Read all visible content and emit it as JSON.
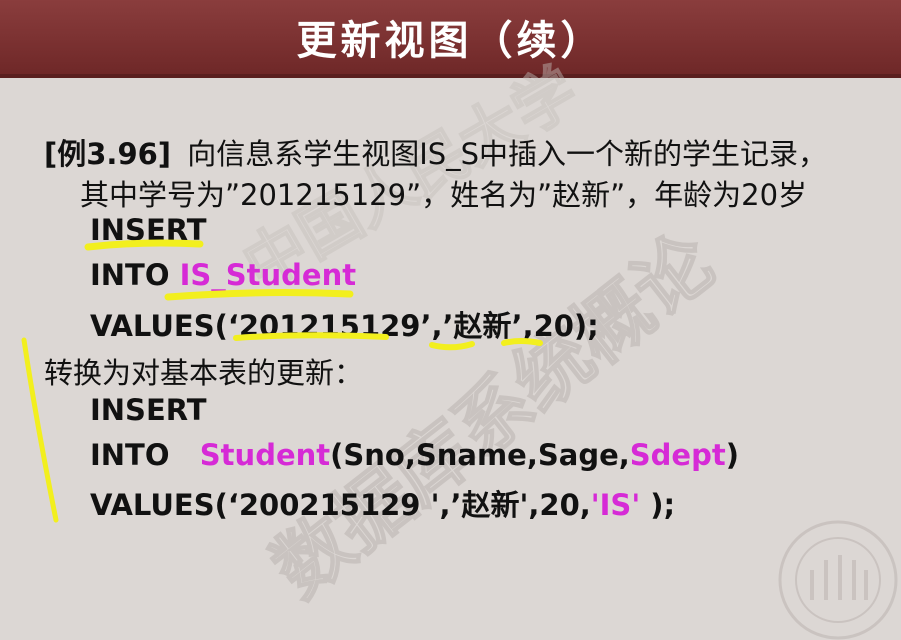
{
  "slide": {
    "title": "更新视图（续）",
    "example": {
      "tag": "[例3.96]",
      "desc1": "向信息系学生视图IS_S中插入一个新的学生记录，",
      "desc2": "其中学号为”201215129”，姓名为”赵新”，年龄为20岁"
    },
    "code1": {
      "insert": "INSERT",
      "into_kw": "INTO ",
      "into_target": "IS_Student",
      "values": "VALUES(‘201215129’,’赵新’,20);"
    },
    "convert_label": "转换为对基本表的更新：",
    "code2": {
      "insert": "INSERT",
      "into_kw": "INTO   ",
      "into_table": "Student",
      "into_cols_a": "(Sno,Sname,Sage,",
      "into_col_hl": "Sdept",
      "into_cols_b": ")",
      "values_a": "VALUES(‘200215129 ',’赵新',20,",
      "values_hl": "'IS'",
      "values_b": " );"
    },
    "watermark": "数据库系统概论",
    "watermark2": "中国人民大学",
    "colors": {
      "title_bg": "#7a2f2f",
      "highlight_text": "#d62ad6",
      "marker": "#f2ef1e"
    }
  }
}
